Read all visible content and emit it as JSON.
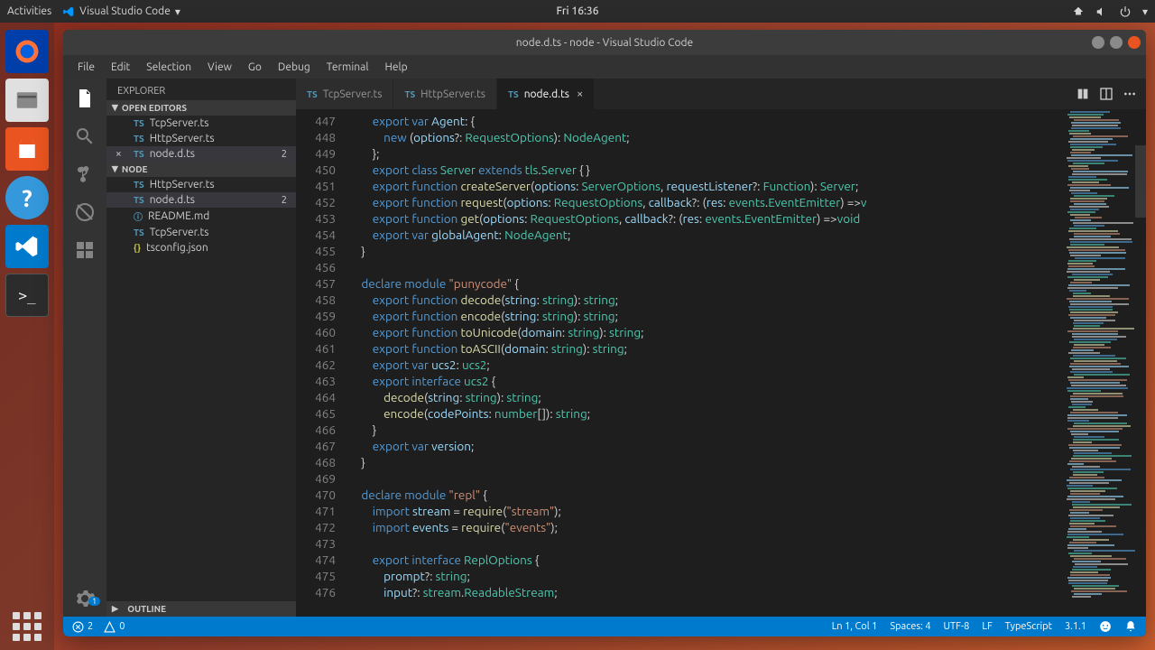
{
  "ubuntu_top": {
    "activities": "Activities",
    "app_title": "Visual Studio Code",
    "clock": "Fri 16:36"
  },
  "window": {
    "title": "node.d.ts - node - Visual Studio Code"
  },
  "menu": [
    "File",
    "Edit",
    "Selection",
    "View",
    "Go",
    "Debug",
    "Terminal",
    "Help"
  ],
  "explorer": {
    "title": "EXPLORER",
    "open_editors_label": "OPEN EDITORS",
    "open_editors": [
      {
        "icon": "TS",
        "name": "TcpServer.ts"
      },
      {
        "icon": "TS",
        "name": "HttpServer.ts"
      },
      {
        "icon": "TS",
        "name": "node.d.ts",
        "badge": "2",
        "active": true
      }
    ],
    "project_label": "NODE",
    "project_files": [
      {
        "icon": "TS",
        "name": "HttpServer.ts"
      },
      {
        "icon": "TS",
        "name": "node.d.ts",
        "badge": "2",
        "active": true
      },
      {
        "icon": "ⓘ",
        "name": "README.md",
        "iconcls": "md"
      },
      {
        "icon": "TS",
        "name": "TcpServer.ts"
      },
      {
        "icon": "{}",
        "name": "tsconfig.json",
        "iconcls": "json"
      }
    ],
    "outline_label": "OUTLINE"
  },
  "tabs": [
    {
      "icon": "TS",
      "name": "TcpServer.ts"
    },
    {
      "icon": "TS",
      "name": "HttpServer.ts"
    },
    {
      "icon": "TS",
      "name": "node.d.ts",
      "active": true,
      "closable": true
    }
  ],
  "line_start": 447,
  "line_end": 476,
  "status": {
    "errors": "2",
    "warnings": "0",
    "cursor": "Ln 1, Col 1",
    "spaces": "Spaces: 4",
    "encoding": "UTF-8",
    "eol": "LF",
    "lang": "TypeScript",
    "ts_ver": "3.1.1"
  },
  "gear_badge": "1"
}
